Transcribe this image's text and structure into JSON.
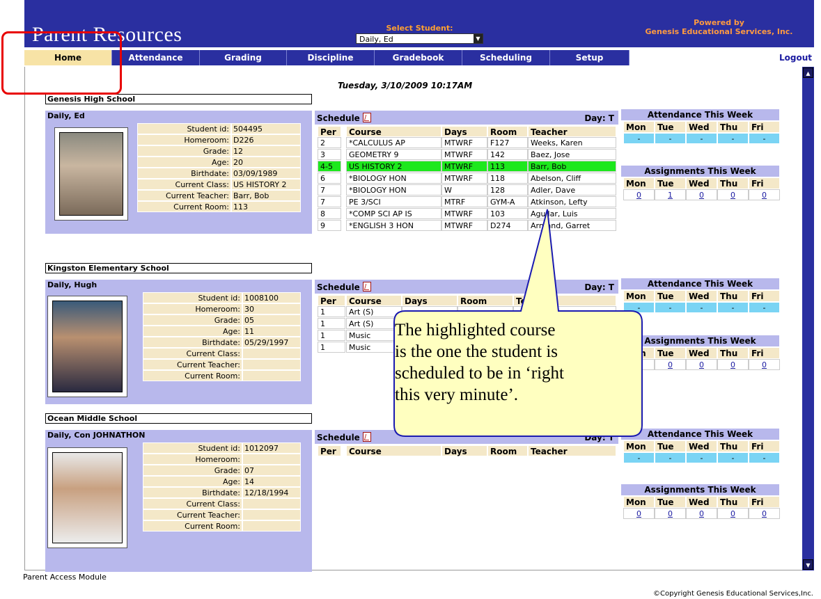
{
  "header": {
    "title": "Parent Resources",
    "select_student_label": "Select Student:",
    "selected_student": "Daily, Ed",
    "powered_line1": "Powered by",
    "powered_line2": "Genesis Educational Services, Inc."
  },
  "nav": {
    "items": [
      "Home",
      "Attendance",
      "Grading",
      "Discipline",
      "Gradebook",
      "Scheduling",
      "Setup"
    ],
    "active": "Home",
    "logout": "Logout"
  },
  "datetime": "Tuesday, 3/10/2009 10:17AM",
  "info_labels": [
    "Student id:",
    "Homeroom:",
    "Grade:",
    "Age:",
    "Birthdate:",
    "Current Class:",
    "Current Teacher:",
    "Current Room:"
  ],
  "schedule_label": "Schedule",
  "schedule_columns": [
    "Per",
    "Course",
    "Days",
    "Room",
    "Teacher"
  ],
  "days": [
    "Mon",
    "Tue",
    "Wed",
    "Thu",
    "Fri"
  ],
  "attendance_title": "Attendance This Week",
  "assignments_title": "Assignments This Week",
  "students": [
    {
      "school": "Genesis High School",
      "name": "Daily, Ed",
      "info": [
        "504495",
        "D226",
        "12",
        "20",
        "03/09/1989",
        "US HISTORY 2",
        "Barr, Bob",
        "113"
      ],
      "day": "Day: T",
      "schedule": [
        [
          "2",
          "*CALCULUS AP",
          "MTWRF",
          "F127",
          "Weeks, Karen"
        ],
        [
          "3",
          "GEOMETRY 9",
          "MTWRF",
          "142",
          "Baez, Jose"
        ],
        [
          "4-5",
          "US HISTORY 2",
          "MTWRF",
          "113",
          "Barr, Bob"
        ],
        [
          "6",
          "*BIOLOGY HON",
          "MTWRF",
          "118",
          "Abelson, Cliff"
        ],
        [
          "7",
          "*BIOLOGY HON",
          "W",
          "128",
          "Adler, Dave"
        ],
        [
          "7",
          "PE 3/SCI",
          "MTRF",
          "GYM-A",
          "Atkinson, Lefty"
        ],
        [
          "8",
          "*COMP SCI AP IS",
          "MTWRF",
          "103",
          "Aguilar, Luis"
        ],
        [
          "9",
          "*ENGLISH 3 HON",
          "MTWRF",
          "D274",
          "Armand, Garret"
        ]
      ],
      "highlight_row": 2,
      "attendance": [
        "-",
        "-",
        "-",
        "-",
        "-"
      ],
      "assignments": [
        "0",
        "1",
        "0",
        "0",
        "0"
      ]
    },
    {
      "school": "Kingston Elementary School",
      "name": "Daily, Hugh",
      "info": [
        "1008100",
        "30",
        "05",
        "11",
        "05/29/1997",
        "",
        "",
        ""
      ],
      "day": "Day: T",
      "schedule": [
        [
          "1",
          "Art (S)",
          "",
          "",
          ""
        ],
        [
          "1",
          "Art (S)",
          "",
          "",
          ""
        ],
        [
          "1",
          "Music",
          "",
          "",
          ""
        ],
        [
          "1",
          "Music",
          "",
          "",
          ""
        ]
      ],
      "highlight_row": -1,
      "attendance": [
        "-",
        "-",
        "-",
        "-",
        "-"
      ],
      "assignments": [
        "0",
        "0",
        "0",
        "0",
        "0"
      ]
    },
    {
      "school": "Ocean Middle School",
      "name": "Daily, Con JOHNATHON",
      "info": [
        "1012097",
        "",
        "07",
        "14",
        "12/18/1994",
        "",
        "",
        ""
      ],
      "day": "Day: T",
      "schedule": [],
      "highlight_row": -1,
      "attendance": [
        "-",
        "-",
        "-",
        "-",
        "-"
      ],
      "assignments": [
        "0",
        "0",
        "0",
        "0",
        "0"
      ]
    }
  ],
  "callout": {
    "lines": [
      "The highlighted course",
      "is the one the student is",
      "scheduled to be in ‘right",
      "this very minute’."
    ]
  },
  "footer": {
    "left": "Parent Access Module",
    "right": "©Copyright Genesis Educational Services,Inc."
  },
  "colors": {
    "nav_bg": "#2a2fa0",
    "active_tab": "#f7e3a6",
    "highlight": "#1de81d",
    "panel_header": "#b8b8ec",
    "attendance_cell": "#7ad4f4",
    "callout_fill": "#ffffc0"
  }
}
